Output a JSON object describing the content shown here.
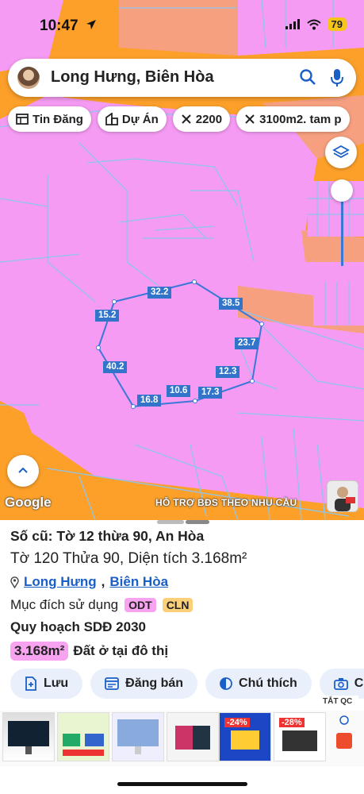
{
  "status_bar": {
    "time": "10:47",
    "battery": "79"
  },
  "search": {
    "query": "Long Hưng, Biên Hòa"
  },
  "chips": [
    {
      "icon": "listing-icon",
      "label": "Tin Đăng"
    },
    {
      "icon": "building-icon",
      "label": "Dự Án"
    },
    {
      "icon": "ruler-icon",
      "label": "2200"
    },
    {
      "icon": "ruler-icon",
      "label": "3100m2. tam p"
    }
  ],
  "map": {
    "attribution": "Google",
    "support_text": "HỖ TRỢ BĐS  THEO NHU CẦU",
    "dimensions": [
      "32.2",
      "38.5",
      "15.2",
      "23.7",
      "40.2",
      "12.3",
      "10.6",
      "17.3",
      "16.8"
    ],
    "colors": {
      "zone_pink": "#f59bf3",
      "zone_orange": "#fca02a",
      "zone_salmon": "#f7a080",
      "road": "#8fc4ec"
    }
  },
  "sheet": {
    "old_ref": "Số cũ: Tờ 12 thừa 90, An Hòa",
    "parcel": "Tờ 120 Thửa 90, Diện tích 3.168m²",
    "ward": "Long Hưng",
    "city": "Biên Hòa",
    "purpose_label": "Mục đích sử dụng",
    "purpose_tags": [
      {
        "code": "ODT",
        "color": "#f7a3f0"
      },
      {
        "code": "CLN",
        "color": "#fcd07a"
      }
    ],
    "plan_label": "Quy hoạch SDĐ 2030",
    "area_value": "3.168m²",
    "area_label": "Đất ở tại đô thị",
    "actions": [
      {
        "icon": "save-icon",
        "label": "Lưu"
      },
      {
        "icon": "post-icon",
        "label": "Đăng bán"
      },
      {
        "icon": "legend-icon",
        "label": "Chú thích"
      },
      {
        "icon": "camera-icon",
        "label": "C"
      }
    ]
  },
  "ads": {
    "close_label": "TẮT QC",
    "discounts": [
      "-24%",
      "-28%"
    ]
  }
}
